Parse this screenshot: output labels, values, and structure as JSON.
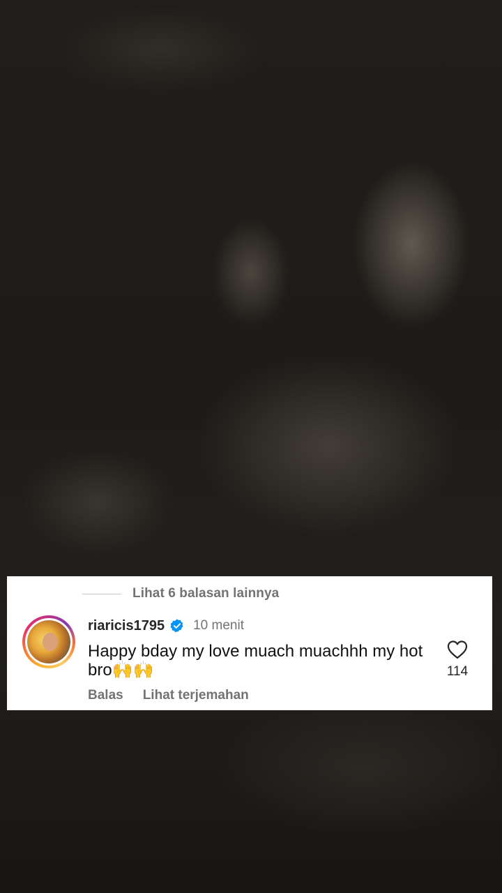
{
  "comment_card": {
    "more_replies": "Lihat 6 balasan lainnya",
    "username": "riaricis1795",
    "verified": true,
    "time": "10 menit",
    "comment_text": "Happy bday my love muach muachhh my hot bro🙌🙌",
    "actions": {
      "reply": "Balas",
      "translate": "Lihat terjemahan"
    },
    "like_count": "114"
  },
  "icons": {
    "verified": "verified-badge-icon",
    "like": "heart-outline-icon"
  },
  "colors": {
    "verified_blue": "#0095f6",
    "secondary_text": "#737373",
    "primary_text": "#262626"
  }
}
